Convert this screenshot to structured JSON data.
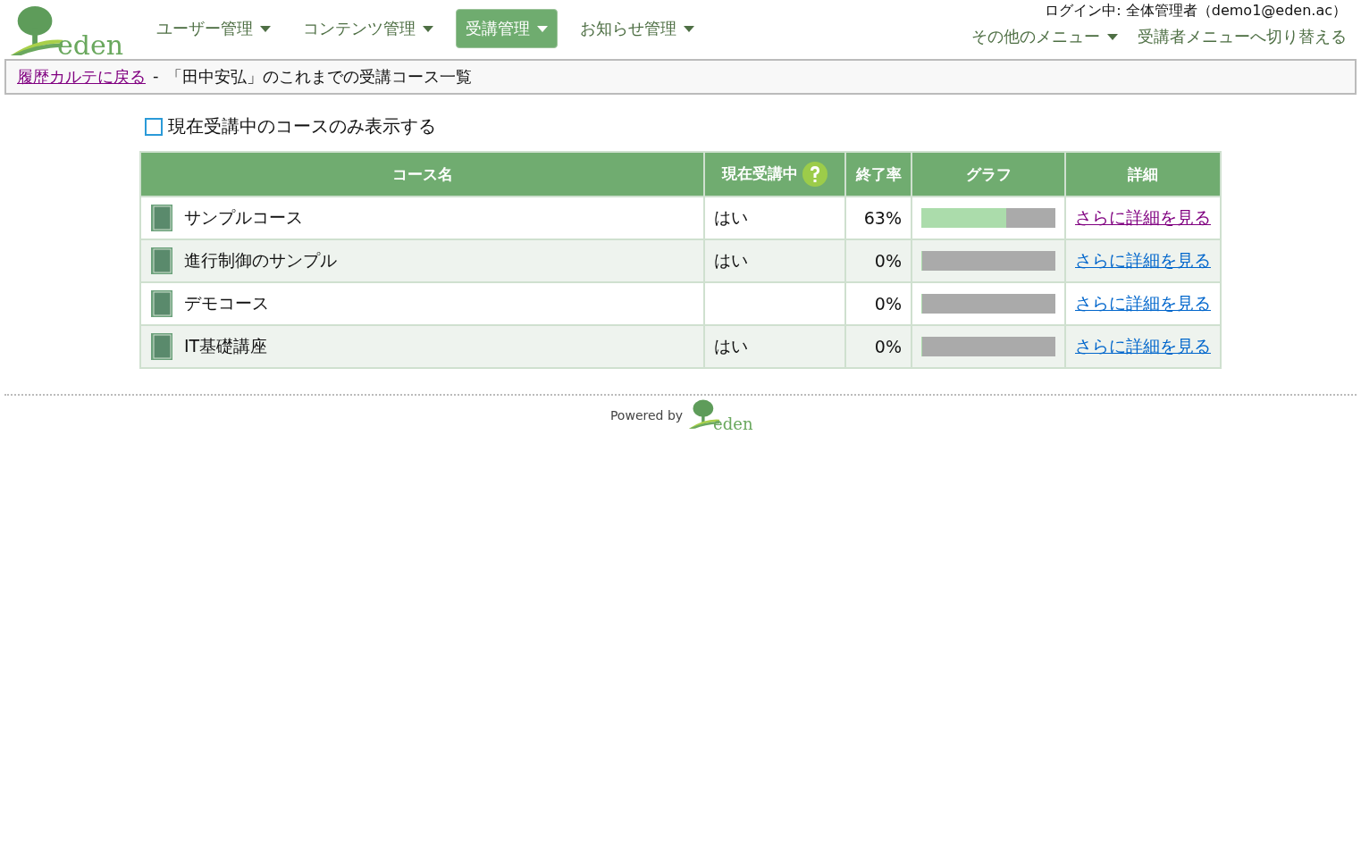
{
  "header": {
    "logo_text": "eden",
    "nav": [
      {
        "label": "ユーザー管理",
        "selected": false
      },
      {
        "label": "コンテンツ管理",
        "selected": false
      },
      {
        "label": "受講管理",
        "selected": true
      },
      {
        "label": "お知らせ管理",
        "selected": false
      }
    ],
    "login": "ログイン中: 全体管理者（demo1@eden.ac）",
    "other_menu": "その他のメニュー",
    "switch_link": "受講者メニューへ切り替える"
  },
  "breadcrumb": {
    "link": "履歴カルテに戻る",
    "separator": "-",
    "title": "「田中安弘」のこれまでの受講コース一覧"
  },
  "filter": {
    "label": "現在受講中のコースのみ表示する",
    "checked": false
  },
  "table": {
    "columns": [
      "コース名",
      "現在受講中",
      "終了率",
      "グラフ",
      "詳細"
    ],
    "rows": [
      {
        "name": "サンプルコース",
        "current": "はい",
        "rate": "63%",
        "level": 0.63,
        "link": "さらに詳細を見る",
        "visited": true
      },
      {
        "name": "進行制御のサンプル",
        "current": "はい",
        "rate": "0%",
        "level": 0,
        "link": "さらに詳細を見る",
        "visited": false
      },
      {
        "name": "デモコース",
        "current": "",
        "rate": "0%",
        "level": 0,
        "link": "さらに詳細を見る",
        "visited": false
      },
      {
        "name": "IT基礎講座",
        "current": "はい",
        "rate": "0%",
        "level": 0,
        "link": "さらに詳細を見る",
        "visited": false
      }
    ]
  },
  "footer": {
    "powered": "Powered by",
    "logo_text": "eden"
  }
}
